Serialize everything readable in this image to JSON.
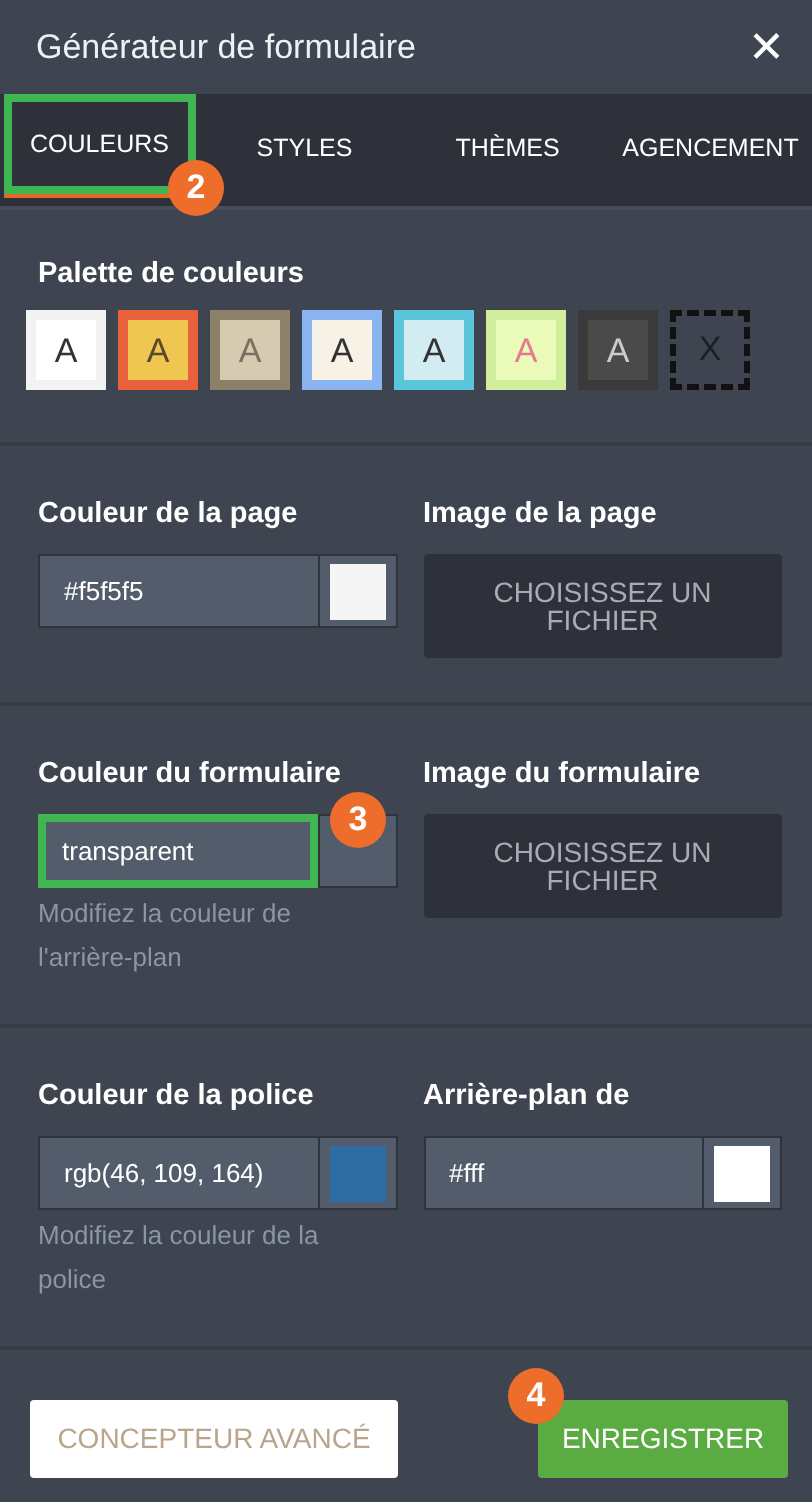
{
  "window": {
    "title": "Générateur de formulaire",
    "close": "✕"
  },
  "tabs": [
    {
      "label": "COULEURS",
      "selected": true,
      "highlighted": true,
      "callout": "2"
    },
    {
      "label": "STYLES",
      "selected": false
    },
    {
      "label": "THÈMES",
      "selected": false
    },
    {
      "label": "AGENCEMENT",
      "selected": false
    }
  ],
  "palette": {
    "title": "Palette de couleurs",
    "swatches": [
      {
        "kind": "theme",
        "frame": {
          "color": "#f2f2f2"
        },
        "fill": {
          "color": "#ffffff"
        },
        "letter": {
          "text": "A",
          "color": "#333333"
        }
      },
      {
        "kind": "theme",
        "frame": {
          "color": "#e8603c"
        },
        "fill": {
          "color": "#efc651"
        },
        "letter": {
          "text": "A",
          "color": "#5a4a2a"
        }
      },
      {
        "kind": "theme",
        "frame": {
          "color": "#8c8068"
        },
        "fill": {
          "color": "#d6cbb0"
        },
        "letter": {
          "text": "A",
          "color": "#7a6f60"
        }
      },
      {
        "kind": "theme",
        "frame": {
          "color": "#8ab4f0"
        },
        "fill": {
          "color": "#f7f1e6"
        },
        "letter": {
          "text": "A",
          "color": "#333333"
        }
      },
      {
        "kind": "theme",
        "frame": {
          "color": "#5bc5dc"
        },
        "fill": {
          "color": "#d3ecf2"
        },
        "letter": {
          "text": "A",
          "color": "#333333"
        }
      },
      {
        "kind": "theme",
        "frame": {
          "color": "#d0ee9b"
        },
        "fill": {
          "color": "#eafab9"
        },
        "letter": {
          "text": "A",
          "color": "#e87a90"
        }
      },
      {
        "kind": "theme",
        "frame": {
          "color": "#3a3a3a"
        },
        "fill": {
          "color": "#4a4a4a"
        },
        "letter": {
          "text": "A",
          "color": "#cccccc"
        }
      },
      {
        "kind": "none",
        "letter": {
          "text": "X"
        }
      }
    ]
  },
  "sections": [
    {
      "fields": [
        {
          "kind": "color",
          "label": "Couleur de la page",
          "value": "#f5f5f5",
          "swatch": {
            "color": "#f5f5f5"
          }
        },
        {
          "kind": "file",
          "label": "Image de la page",
          "button": "CHOISISSEZ UN FICHIER"
        }
      ]
    },
    {
      "fields": [
        {
          "kind": "color",
          "label": "Couleur du formulaire",
          "value": "transparent",
          "highlighted": true,
          "callout": "3",
          "hint": "Modifiez la couleur de l'arrière-plan"
        },
        {
          "kind": "file",
          "label": "Image du formulaire",
          "button": "CHOISISSEZ UN FICHIER"
        }
      ]
    },
    {
      "fields": [
        {
          "kind": "color",
          "label": "Couleur de la police",
          "value": "rgb(46, 109, 164)",
          "swatch": {
            "color": "#2e6da4"
          },
          "hint": "Modifiez la couleur de la police"
        },
        {
          "kind": "color",
          "label": "Arrière-plan de",
          "value": "#fff",
          "swatch": {
            "color": "#ffffff"
          }
        }
      ]
    }
  ],
  "footer": {
    "advanced_button": "CONCEPTEUR AVANCÉ",
    "save_button": "ENREGISTRER",
    "save_callout": "4"
  }
}
